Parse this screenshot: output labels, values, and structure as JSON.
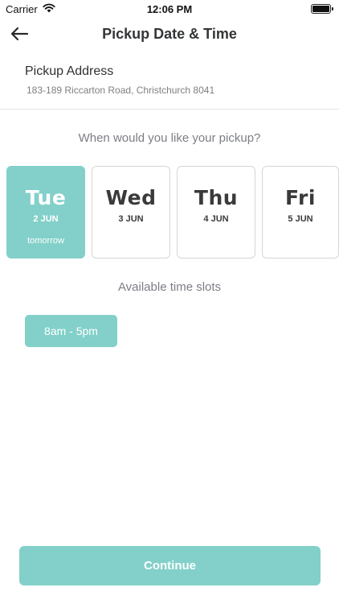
{
  "status_bar": {
    "carrier": "Carrier",
    "time": "12:06 PM",
    "battery_level": 1.0
  },
  "nav": {
    "title": "Pickup Date & Time",
    "back_icon": "arrow-left-icon"
  },
  "address": {
    "label": "Pickup Address",
    "value": "183-189 Riccarton Road, Christchurch 8041"
  },
  "question": "When would you like your pickup?",
  "days": [
    {
      "name": "Tue",
      "date": "2 JUN",
      "note": "tomorrow",
      "selected": true
    },
    {
      "name": "Wed",
      "date": "3 JUN",
      "note": "",
      "selected": false
    },
    {
      "name": "Thu",
      "date": "4 JUN",
      "note": "",
      "selected": false
    },
    {
      "name": "Fri",
      "date": "5 JUN",
      "note": "",
      "selected": false
    }
  ],
  "slots_heading": "Available time slots",
  "slots": [
    {
      "label": "8am - 5pm"
    }
  ],
  "continue_label": "Continue",
  "colors": {
    "accent": "#82d0c9",
    "text_dark": "#2f3133",
    "text_muted": "#7c7e86",
    "border": "#d6d6d6"
  }
}
